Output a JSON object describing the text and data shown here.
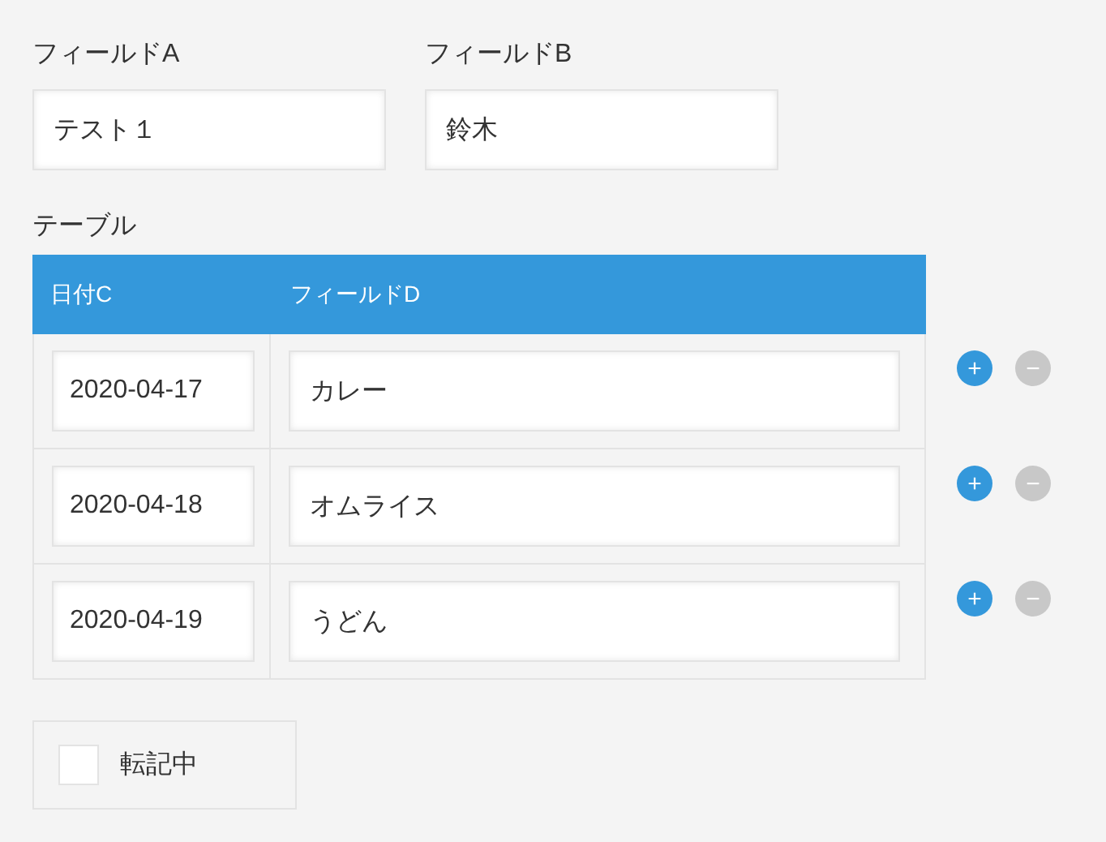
{
  "fields": [
    {
      "label": "フィールドA",
      "value": "テスト１"
    },
    {
      "label": "フィールドB",
      "value": "鈴木"
    }
  ],
  "table": {
    "label": "テーブル",
    "columns": [
      "日付C",
      "フィールドD"
    ],
    "rows": [
      {
        "date": "2020-04-17",
        "value": "カレー"
      },
      {
        "date": "2020-04-18",
        "value": "オムライス"
      },
      {
        "date": "2020-04-19",
        "value": "うどん"
      }
    ],
    "add_button": "+",
    "remove_button": "−"
  },
  "checkbox": {
    "label": "転記中",
    "checked": false
  }
}
